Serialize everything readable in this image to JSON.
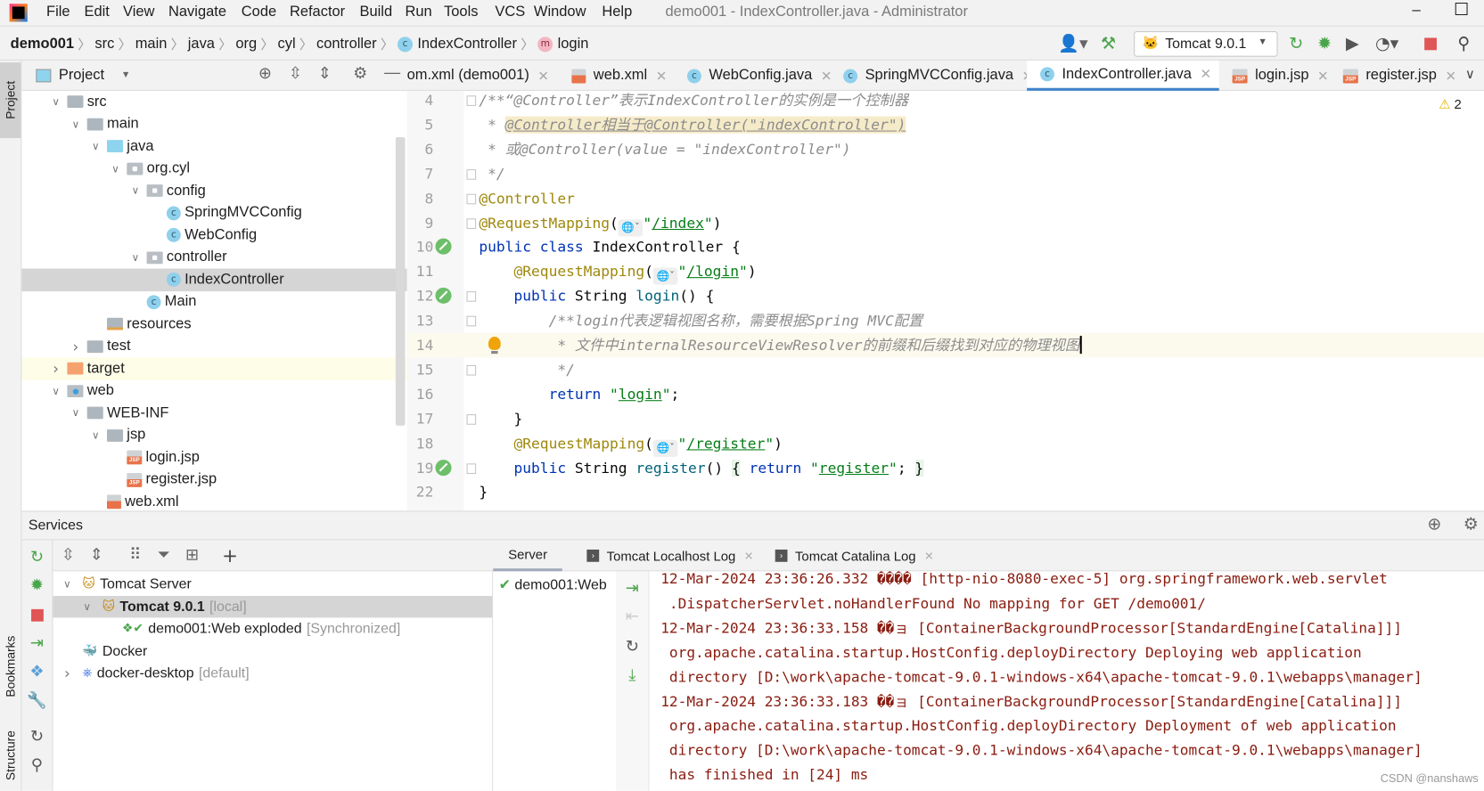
{
  "app": {
    "title": "demo001 - IndexController.java - Administrator",
    "menu": [
      "File",
      "Edit",
      "View",
      "Navigate",
      "Code",
      "Refactor",
      "Build",
      "Run",
      "Tools",
      "VCS",
      "Window",
      "Help"
    ],
    "window_controls": {
      "minimize": "–",
      "maximize": "☐"
    }
  },
  "breadcrumb": [
    "demo001",
    "src",
    "main",
    "java",
    "org",
    "cyl",
    "controller",
    "IndexController",
    "login"
  ],
  "toolbar": {
    "run_config": "Tomcat 9.0.1"
  },
  "side_tabs": {
    "project": "Project",
    "bookmarks": "Bookmarks",
    "structure": "Structure"
  },
  "project_panel": {
    "title": "Project",
    "tree": [
      {
        "label": "src",
        "depth": 0,
        "arrow": "open",
        "icon": "folder"
      },
      {
        "label": "main",
        "depth": 1,
        "arrow": "open",
        "icon": "folder"
      },
      {
        "label": "java",
        "depth": 2,
        "arrow": "open",
        "icon": "folder-blue"
      },
      {
        "label": "org.cyl",
        "depth": 3,
        "arrow": "open",
        "icon": "pkg"
      },
      {
        "label": "config",
        "depth": 4,
        "arrow": "open",
        "icon": "pkg"
      },
      {
        "label": "SpringMVCConfig",
        "depth": 5,
        "arrow": "none",
        "icon": "cls"
      },
      {
        "label": "WebConfig",
        "depth": 5,
        "arrow": "none",
        "icon": "cls"
      },
      {
        "label": "controller",
        "depth": 4,
        "arrow": "open",
        "icon": "pkg"
      },
      {
        "label": "IndexController",
        "depth": 5,
        "arrow": "none",
        "icon": "cls",
        "selected": true
      },
      {
        "label": "Main",
        "depth": 4,
        "arrow": "none",
        "icon": "cls"
      },
      {
        "label": "resources",
        "depth": 2,
        "arrow": "none",
        "icon": "res"
      },
      {
        "label": "test",
        "depth": 1,
        "arrow": "closed",
        "icon": "folder"
      },
      {
        "label": "target",
        "depth": 0,
        "arrow": "closed",
        "icon": "folder-orange",
        "highlight": true
      },
      {
        "label": "web",
        "depth": 0,
        "arrow": "open",
        "icon": "webf"
      },
      {
        "label": "WEB-INF",
        "depth": 1,
        "arrow": "open",
        "icon": "folder"
      },
      {
        "label": "jsp",
        "depth": 2,
        "arrow": "open",
        "icon": "folder"
      },
      {
        "label": "login.jsp",
        "depth": 3,
        "arrow": "none",
        "icon": "jsp"
      },
      {
        "label": "register.jsp",
        "depth": 3,
        "arrow": "none",
        "icon": "jsp"
      },
      {
        "label": "web.xml",
        "depth": 2,
        "arrow": "none",
        "icon": "xml"
      }
    ]
  },
  "editor_tabs": [
    {
      "label": "om.xml (demo001)",
      "icon": "none"
    },
    {
      "label": "web.xml",
      "icon": "xml"
    },
    {
      "label": "WebConfig.java",
      "icon": "cls"
    },
    {
      "label": "SpringMVCConfig.java",
      "icon": "cls"
    },
    {
      "label": "IndexController.java",
      "icon": "cls",
      "active": true
    },
    {
      "label": "login.jsp",
      "icon": "jsp"
    },
    {
      "label": "register.jsp",
      "icon": "jsp"
    }
  ],
  "editor": {
    "warnings": "2",
    "lines": [
      {
        "num": "4",
        "fold": true,
        "tokens": [
          {
            "c": "comment",
            "t": "/**“@Controller”表示IndexController的实例是一个控制器"
          }
        ]
      },
      {
        "num": "5",
        "tokens": [
          {
            "c": "comment",
            "t": " * "
          },
          {
            "c": "commentu",
            "t": "@Controller相当于@Controller(\"indexController\")"
          }
        ]
      },
      {
        "num": "6",
        "tokens": [
          {
            "c": "comment",
            "t": " * 或@Controller(value = \"indexController\")"
          }
        ]
      },
      {
        "num": "7",
        "fold": true,
        "tokens": [
          {
            "c": "comment",
            "t": " */"
          }
        ]
      },
      {
        "num": "8",
        "fold": true,
        "tokens": [
          {
            "c": "ann",
            "t": "@Controller"
          }
        ]
      },
      {
        "num": "9",
        "fold": true,
        "tokens": [
          {
            "c": "ann",
            "t": "@RequestMapping"
          },
          {
            "c": "plain",
            "t": "("
          },
          {
            "c": "inlay"
          },
          {
            "c": "str",
            "t": "\""
          },
          {
            "c": "strlink",
            "t": "/index"
          },
          {
            "c": "str",
            "t": "\""
          },
          {
            "c": "plain",
            "t": ")"
          }
        ]
      },
      {
        "num": "10",
        "gutter": "bean",
        "tokens": [
          {
            "c": "kw",
            "t": "public class "
          },
          {
            "c": "plain",
            "t": "IndexController {"
          }
        ]
      },
      {
        "num": "11",
        "tokens": [
          {
            "c": "plain",
            "t": "    "
          },
          {
            "c": "ann",
            "t": "@RequestMapping"
          },
          {
            "c": "plain",
            "t": "("
          },
          {
            "c": "inlay"
          },
          {
            "c": "str",
            "t": "\""
          },
          {
            "c": "strlink",
            "t": "/login"
          },
          {
            "c": "str",
            "t": "\""
          },
          {
            "c": "plain",
            "t": ")"
          }
        ]
      },
      {
        "num": "12",
        "gutter": "bean",
        "fold": true,
        "tokens": [
          {
            "c": "plain",
            "t": "    "
          },
          {
            "c": "kw",
            "t": "public "
          },
          {
            "c": "plain",
            "t": "String "
          },
          {
            "c": "fn",
            "t": "login"
          },
          {
            "c": "plain",
            "t": "() {"
          }
        ]
      },
      {
        "num": "13",
        "fold": true,
        "tokens": [
          {
            "c": "plain",
            "t": "        "
          },
          {
            "c": "comment",
            "t": "/**login代表逻辑视图名称，需要根据Spring MVC配置"
          }
        ]
      },
      {
        "num": "14",
        "current": true,
        "bulb": true,
        "caret": true,
        "tokens": [
          {
            "c": "plain",
            "t": "         "
          },
          {
            "c": "comment",
            "t": "* 文件中internalResourceViewResolver的前缀和后缀找到对应的物理视图"
          }
        ]
      },
      {
        "num": "15",
        "fold": true,
        "tokens": [
          {
            "c": "plain",
            "t": "         "
          },
          {
            "c": "comment",
            "t": "*/"
          }
        ]
      },
      {
        "num": "16",
        "tokens": [
          {
            "c": "plain",
            "t": "        "
          },
          {
            "c": "kw",
            "t": "return "
          },
          {
            "c": "str",
            "t": "\""
          },
          {
            "c": "strlink",
            "t": "login"
          },
          {
            "c": "str",
            "t": "\""
          },
          {
            "c": "plain",
            "t": ";"
          }
        ]
      },
      {
        "num": "17",
        "fold": true,
        "tokens": [
          {
            "c": "plain",
            "t": "    }"
          }
        ]
      },
      {
        "num": "18",
        "tokens": [
          {
            "c": "plain",
            "t": "    "
          },
          {
            "c": "ann",
            "t": "@RequestMapping"
          },
          {
            "c": "plain",
            "t": "("
          },
          {
            "c": "inlay"
          },
          {
            "c": "str",
            "t": "\""
          },
          {
            "c": "strlink",
            "t": "/register"
          },
          {
            "c": "str",
            "t": "\""
          },
          {
            "c": "plain",
            "t": ")"
          }
        ]
      },
      {
        "num": "19",
        "gutter": "bean",
        "fold": true,
        "tokens": [
          {
            "c": "plain",
            "t": "    "
          },
          {
            "c": "kw",
            "t": "public "
          },
          {
            "c": "plain",
            "t": "String "
          },
          {
            "c": "fn",
            "t": "register"
          },
          {
            "c": "plain",
            "t": "() "
          },
          {
            "c": "fold",
            "t": "{"
          },
          {
            "c": "plain",
            "t": " "
          },
          {
            "c": "kw",
            "t": "return "
          },
          {
            "c": "str",
            "t": "\""
          },
          {
            "c": "strlink",
            "t": "register"
          },
          {
            "c": "str",
            "t": "\""
          },
          {
            "c": "plain",
            "t": "; "
          },
          {
            "c": "fold",
            "t": "}"
          }
        ]
      },
      {
        "num": "22",
        "tokens": [
          {
            "c": "plain",
            "t": "}"
          }
        ]
      }
    ]
  },
  "services": {
    "title": "Services",
    "tree": [
      {
        "label": "Tomcat Server",
        "depth": 0,
        "arrow": "open",
        "icon": "tomcat"
      },
      {
        "label": "Tomcat 9.0.1",
        "extra": "[local]",
        "depth": 1,
        "arrow": "open",
        "icon": "tomcat",
        "selected": true,
        "bold": true
      },
      {
        "label": "demo001:Web exploded",
        "extra": "[Synchronized]",
        "depth": 2,
        "arrow": "none",
        "icon": "artifact"
      },
      {
        "label": "Docker",
        "depth": 0,
        "arrow": "none",
        "icon": "docker"
      },
      {
        "label": "docker-desktop",
        "extra": "[default]",
        "depth": 0,
        "arrow": "closed",
        "icon": "k8s"
      }
    ],
    "tabs": [
      {
        "label": "Server",
        "active": true
      },
      {
        "label": "Tomcat Localhost Log",
        "closable": true
      },
      {
        "label": "Tomcat Catalina Log",
        "closable": true
      }
    ],
    "deployments": [
      "demo001:Web"
    ],
    "console": [
      "12-Mar-2024 23:36:26.332 ���� [http-nio-8080-exec-5] org.springframework.web.servlet",
      " .DispatcherServlet.noHandlerFound No mapping for GET /demo001/",
      "12-Mar-2024 23:36:33.158 ��ョ [ContainerBackgroundProcessor[StandardEngine[Catalina]]]",
      " org.apache.catalina.startup.HostConfig.deployDirectory Deploying web application",
      " directory [D:\\work\\apache-tomcat-9.0.1-windows-x64\\apache-tomcat-9.0.1\\webapps\\manager]",
      "12-Mar-2024 23:36:33.183 ��ョ [ContainerBackgroundProcessor[StandardEngine[Catalina]]]",
      " org.apache.catalina.startup.HostConfig.deployDirectory Deployment of web application",
      " directory [D:\\work\\apache-tomcat-9.0.1-windows-x64\\apache-tomcat-9.0.1\\webapps\\manager]",
      " has finished in [24] ms"
    ]
  },
  "watermark": "CSDN @nanshaws"
}
